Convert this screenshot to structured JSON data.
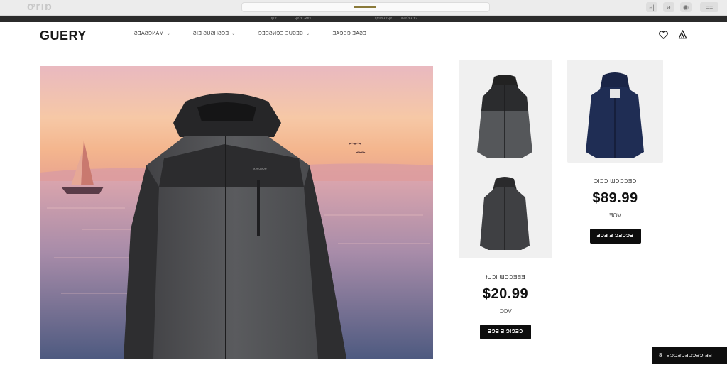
{
  "browser": {
    "logo_text": "ơrıɒ",
    "toolbar_labels": [
      "ǝ|",
      "ǝ",
      "◉",
      "=="
    ],
    "strip_labels": [
      "ıʞıɐ",
      "ɥɐʇɐ ʍɐɹ",
      "ʞɐɔɐɹɐɥɐ",
      "ɔɹɐʇɐɹ ɐɹ"
    ]
  },
  "header": {
    "brand": "GUERY",
    "nav": [
      {
        "label": "ƧƎAƧƆИAM",
        "caret": "⌄",
        "active": true
      },
      {
        "label": "ƧIƎ ƧUƧHƧƆƎ",
        "caret": "⌄",
        "active": false
      },
      {
        "label": "ƆƎƎƧИƆƎ ƎUƧƎƧ",
        "caret": "⌄",
        "active": false
      },
      {
        "label": "ƎAƆƧƆ ƎAƧƎ",
        "caret": "",
        "active": false
      }
    ],
    "icons": [
      "heart-icon",
      "bag-icon"
    ]
  },
  "products": [
    {
      "name": "ƗUƆƖ ƜƆƆƎƎƎ",
      "price": "$20.99",
      "currency": "ƆOV",
      "button": "ƎƆƎ Ǝ ƆƖƆƎƆ"
    },
    {
      "name": "ƆƖƆƆ ƜƆƆƆƎƆ",
      "price": "$89.99",
      "currency": "ƎOV",
      "button": "ƎƆƎ Ǝ ƆƎƆƆƎ"
    }
  ],
  "chat_widget": {
    "icon": "8",
    "label": "ƎƆƆƎƆƎƆƆƎƆ ƎƎ"
  },
  "colors": {
    "accent": "#c0602e",
    "dark": "#0d0d0d",
    "navy_jacket": "#1f2d54",
    "charcoal_jacket": "#3d3e40"
  }
}
